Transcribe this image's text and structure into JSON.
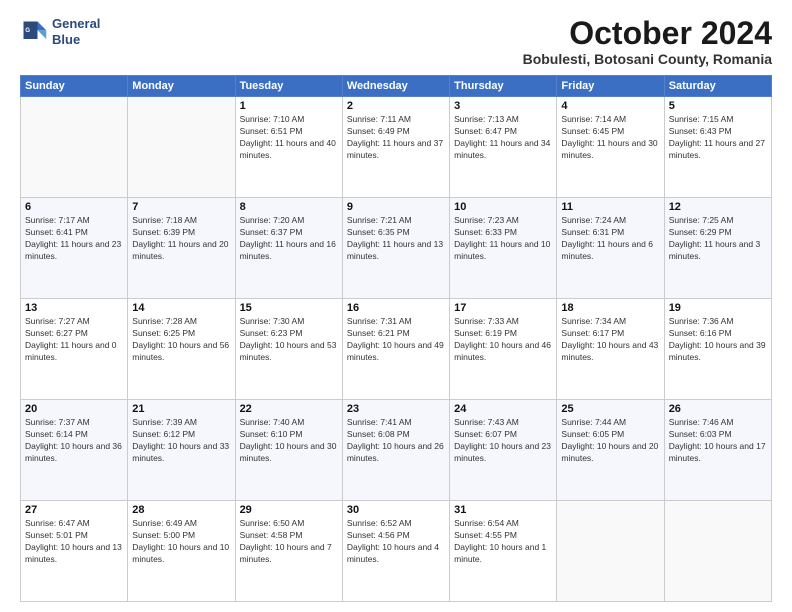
{
  "header": {
    "logo_line1": "General",
    "logo_line2": "Blue",
    "month_title": "October 2024",
    "subtitle": "Bobulesti, Botosani County, Romania"
  },
  "weekdays": [
    "Sunday",
    "Monday",
    "Tuesday",
    "Wednesday",
    "Thursday",
    "Friday",
    "Saturday"
  ],
  "weeks": [
    [
      {
        "day": "",
        "info": ""
      },
      {
        "day": "",
        "info": ""
      },
      {
        "day": "1",
        "info": "Sunrise: 7:10 AM\nSunset: 6:51 PM\nDaylight: 11 hours and 40 minutes."
      },
      {
        "day": "2",
        "info": "Sunrise: 7:11 AM\nSunset: 6:49 PM\nDaylight: 11 hours and 37 minutes."
      },
      {
        "day": "3",
        "info": "Sunrise: 7:13 AM\nSunset: 6:47 PM\nDaylight: 11 hours and 34 minutes."
      },
      {
        "day": "4",
        "info": "Sunrise: 7:14 AM\nSunset: 6:45 PM\nDaylight: 11 hours and 30 minutes."
      },
      {
        "day": "5",
        "info": "Sunrise: 7:15 AM\nSunset: 6:43 PM\nDaylight: 11 hours and 27 minutes."
      }
    ],
    [
      {
        "day": "6",
        "info": "Sunrise: 7:17 AM\nSunset: 6:41 PM\nDaylight: 11 hours and 23 minutes."
      },
      {
        "day": "7",
        "info": "Sunrise: 7:18 AM\nSunset: 6:39 PM\nDaylight: 11 hours and 20 minutes."
      },
      {
        "day": "8",
        "info": "Sunrise: 7:20 AM\nSunset: 6:37 PM\nDaylight: 11 hours and 16 minutes."
      },
      {
        "day": "9",
        "info": "Sunrise: 7:21 AM\nSunset: 6:35 PM\nDaylight: 11 hours and 13 minutes."
      },
      {
        "day": "10",
        "info": "Sunrise: 7:23 AM\nSunset: 6:33 PM\nDaylight: 11 hours and 10 minutes."
      },
      {
        "day": "11",
        "info": "Sunrise: 7:24 AM\nSunset: 6:31 PM\nDaylight: 11 hours and 6 minutes."
      },
      {
        "day": "12",
        "info": "Sunrise: 7:25 AM\nSunset: 6:29 PM\nDaylight: 11 hours and 3 minutes."
      }
    ],
    [
      {
        "day": "13",
        "info": "Sunrise: 7:27 AM\nSunset: 6:27 PM\nDaylight: 11 hours and 0 minutes."
      },
      {
        "day": "14",
        "info": "Sunrise: 7:28 AM\nSunset: 6:25 PM\nDaylight: 10 hours and 56 minutes."
      },
      {
        "day": "15",
        "info": "Sunrise: 7:30 AM\nSunset: 6:23 PM\nDaylight: 10 hours and 53 minutes."
      },
      {
        "day": "16",
        "info": "Sunrise: 7:31 AM\nSunset: 6:21 PM\nDaylight: 10 hours and 49 minutes."
      },
      {
        "day": "17",
        "info": "Sunrise: 7:33 AM\nSunset: 6:19 PM\nDaylight: 10 hours and 46 minutes."
      },
      {
        "day": "18",
        "info": "Sunrise: 7:34 AM\nSunset: 6:17 PM\nDaylight: 10 hours and 43 minutes."
      },
      {
        "day": "19",
        "info": "Sunrise: 7:36 AM\nSunset: 6:16 PM\nDaylight: 10 hours and 39 minutes."
      }
    ],
    [
      {
        "day": "20",
        "info": "Sunrise: 7:37 AM\nSunset: 6:14 PM\nDaylight: 10 hours and 36 minutes."
      },
      {
        "day": "21",
        "info": "Sunrise: 7:39 AM\nSunset: 6:12 PM\nDaylight: 10 hours and 33 minutes."
      },
      {
        "day": "22",
        "info": "Sunrise: 7:40 AM\nSunset: 6:10 PM\nDaylight: 10 hours and 30 minutes."
      },
      {
        "day": "23",
        "info": "Sunrise: 7:41 AM\nSunset: 6:08 PM\nDaylight: 10 hours and 26 minutes."
      },
      {
        "day": "24",
        "info": "Sunrise: 7:43 AM\nSunset: 6:07 PM\nDaylight: 10 hours and 23 minutes."
      },
      {
        "day": "25",
        "info": "Sunrise: 7:44 AM\nSunset: 6:05 PM\nDaylight: 10 hours and 20 minutes."
      },
      {
        "day": "26",
        "info": "Sunrise: 7:46 AM\nSunset: 6:03 PM\nDaylight: 10 hours and 17 minutes."
      }
    ],
    [
      {
        "day": "27",
        "info": "Sunrise: 6:47 AM\nSunset: 5:01 PM\nDaylight: 10 hours and 13 minutes."
      },
      {
        "day": "28",
        "info": "Sunrise: 6:49 AM\nSunset: 5:00 PM\nDaylight: 10 hours and 10 minutes."
      },
      {
        "day": "29",
        "info": "Sunrise: 6:50 AM\nSunset: 4:58 PM\nDaylight: 10 hours and 7 minutes."
      },
      {
        "day": "30",
        "info": "Sunrise: 6:52 AM\nSunset: 4:56 PM\nDaylight: 10 hours and 4 minutes."
      },
      {
        "day": "31",
        "info": "Sunrise: 6:54 AM\nSunset: 4:55 PM\nDaylight: 10 hours and 1 minute."
      },
      {
        "day": "",
        "info": ""
      },
      {
        "day": "",
        "info": ""
      }
    ]
  ]
}
